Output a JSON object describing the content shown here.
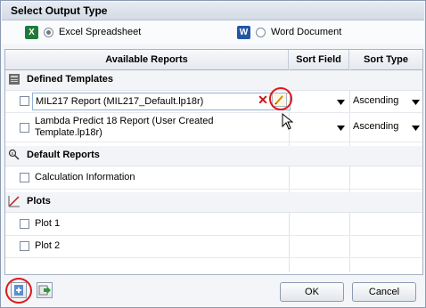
{
  "output_type": {
    "title": "Select Output Type",
    "excel_label": "Excel Spreadsheet",
    "word_label": "Word Document",
    "selected": "Excel Spreadsheet",
    "excel_icon_letter": "X",
    "word_icon_letter": "W"
  },
  "grid": {
    "col_reports": "Available Reports",
    "col_sort_field": "Sort Field",
    "col_sort_type": "Sort Type"
  },
  "sections": {
    "defined": {
      "label": "Defined Templates",
      "icon": "templates-icon",
      "items": [
        {
          "label": "MIL217 Report (MIL217_Default.lp18r)",
          "sort_type": "Ascending",
          "checked": false
        },
        {
          "label": "Lambda Predict 18 Report (User Created",
          "label2": "Template.lp18r)",
          "sort_type": "Ascending",
          "checked": false
        }
      ]
    },
    "default": {
      "label": "Default Reports",
      "icon": "report-icon",
      "items": [
        {
          "label": "Calculation Information",
          "checked": false
        }
      ]
    },
    "plots": {
      "label": "Plots",
      "icon": "plot-icon",
      "items": [
        {
          "label": "Plot 1",
          "checked": false
        },
        {
          "label": "Plot 2",
          "checked": false
        }
      ]
    }
  },
  "footer": {
    "ok_label": "OK",
    "cancel_label": "Cancel",
    "add_icon": "add-template-icon",
    "export_icon": "export-icon"
  },
  "colors": {
    "highlight_circle": "#e01818",
    "header_bg": "#dde3eb",
    "excel_green": "#1f7a3a",
    "word_blue": "#2155a8"
  }
}
